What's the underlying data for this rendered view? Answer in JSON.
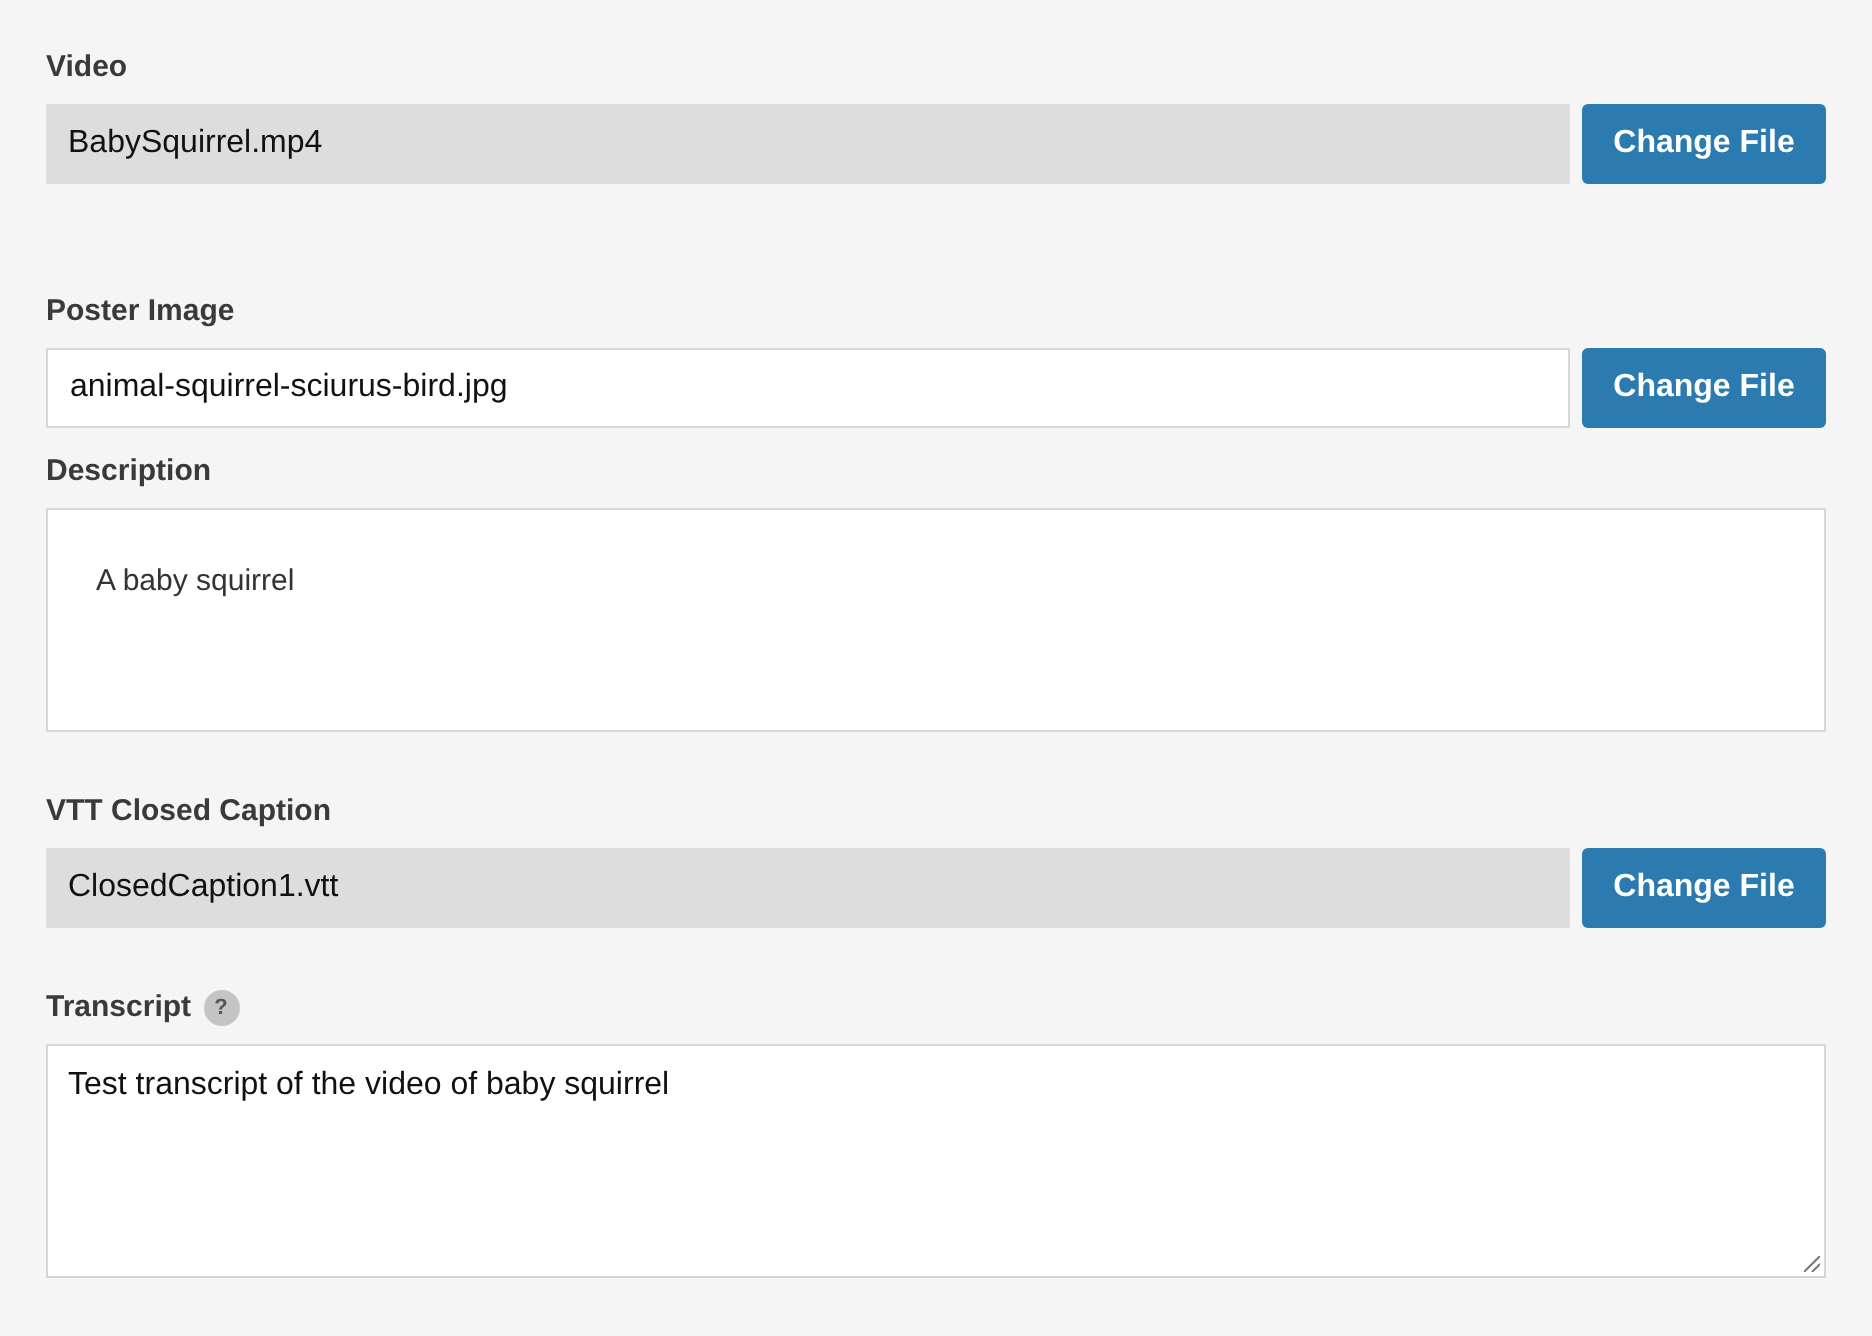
{
  "fields": [
    {
      "kind": "file",
      "label": "Video",
      "value": "BabySquirrel.mp4",
      "disabled": true,
      "button": "Change File"
    },
    {
      "kind": "file",
      "label": "Poster Image",
      "value": "animal-squirrel-sciurus-bird.jpg",
      "disabled": false,
      "button": "Change File"
    },
    {
      "kind": "rich_text",
      "label": "Description",
      "value": "A baby squirrel"
    },
    {
      "kind": "file",
      "label": "VTT Closed Caption",
      "value": "ClosedCaption1.vtt",
      "disabled": true,
      "button": "Change File"
    },
    {
      "kind": "textarea",
      "label": "Transcript",
      "help": "?",
      "value": "Test transcript of the video of baby squirrel"
    }
  ]
}
